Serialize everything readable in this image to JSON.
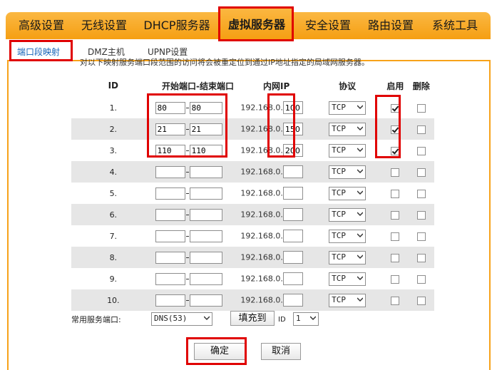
{
  "nav": {
    "items": [
      "高级设置",
      "无线设置",
      "DHCP服务器",
      "虚拟服务器",
      "安全设置",
      "路由设置",
      "系统工具"
    ],
    "active": "虚拟服务器"
  },
  "subnav": {
    "items": [
      "端口段映射",
      "DMZ主机",
      "UPNP设置"
    ],
    "active": "端口段映射"
  },
  "truncated_note": "对以下映射服务端口段范围的访问将会被重定位到通过IP地址指定的局域网服务器。",
  "table": {
    "headers": {
      "id": "ID",
      "ports": "开始端口-结束端口",
      "ip": "内网IP",
      "protocol": "协议",
      "enable": "启用",
      "delete": "删除"
    },
    "ip_prefix": "192.168.0.",
    "rows": [
      {
        "id": "1.",
        "start": "80",
        "end": "80",
        "ip_last": "100",
        "protocol": "TCP",
        "enabled": true,
        "delete": false
      },
      {
        "id": "2.",
        "start": "21",
        "end": "21",
        "ip_last": "150",
        "protocol": "TCP",
        "enabled": true,
        "delete": false
      },
      {
        "id": "3.",
        "start": "110",
        "end": "110",
        "ip_last": "200",
        "protocol": "TCP",
        "enabled": true,
        "delete": false
      },
      {
        "id": "4.",
        "start": "",
        "end": "",
        "ip_last": "",
        "protocol": "TCP",
        "enabled": false,
        "delete": false
      },
      {
        "id": "5.",
        "start": "",
        "end": "",
        "ip_last": "",
        "protocol": "TCP",
        "enabled": false,
        "delete": false
      },
      {
        "id": "6.",
        "start": "",
        "end": "",
        "ip_last": "",
        "protocol": "TCP",
        "enabled": false,
        "delete": false
      },
      {
        "id": "7.",
        "start": "",
        "end": "",
        "ip_last": "",
        "protocol": "TCP",
        "enabled": false,
        "delete": false
      },
      {
        "id": "8.",
        "start": "",
        "end": "",
        "ip_last": "",
        "protocol": "TCP",
        "enabled": false,
        "delete": false
      },
      {
        "id": "9.",
        "start": "",
        "end": "",
        "ip_last": "",
        "protocol": "TCP",
        "enabled": false,
        "delete": false
      },
      {
        "id": "10.",
        "start": "",
        "end": "",
        "ip_last": "",
        "protocol": "TCP",
        "enabled": false,
        "delete": false
      }
    ]
  },
  "common_service": {
    "label": "常用服务端口:",
    "selected": "DNS(53)",
    "fill_button": "填充到",
    "id_label": "ID",
    "id_selected": "1"
  },
  "buttons": {
    "confirm": "确定",
    "cancel": "取消"
  },
  "colors": {
    "nav_orange": "#f7a21a",
    "highlight_red": "#e00000",
    "active_link_blue": "#1463b8",
    "row_alt_gray": "#e6e6e6"
  }
}
